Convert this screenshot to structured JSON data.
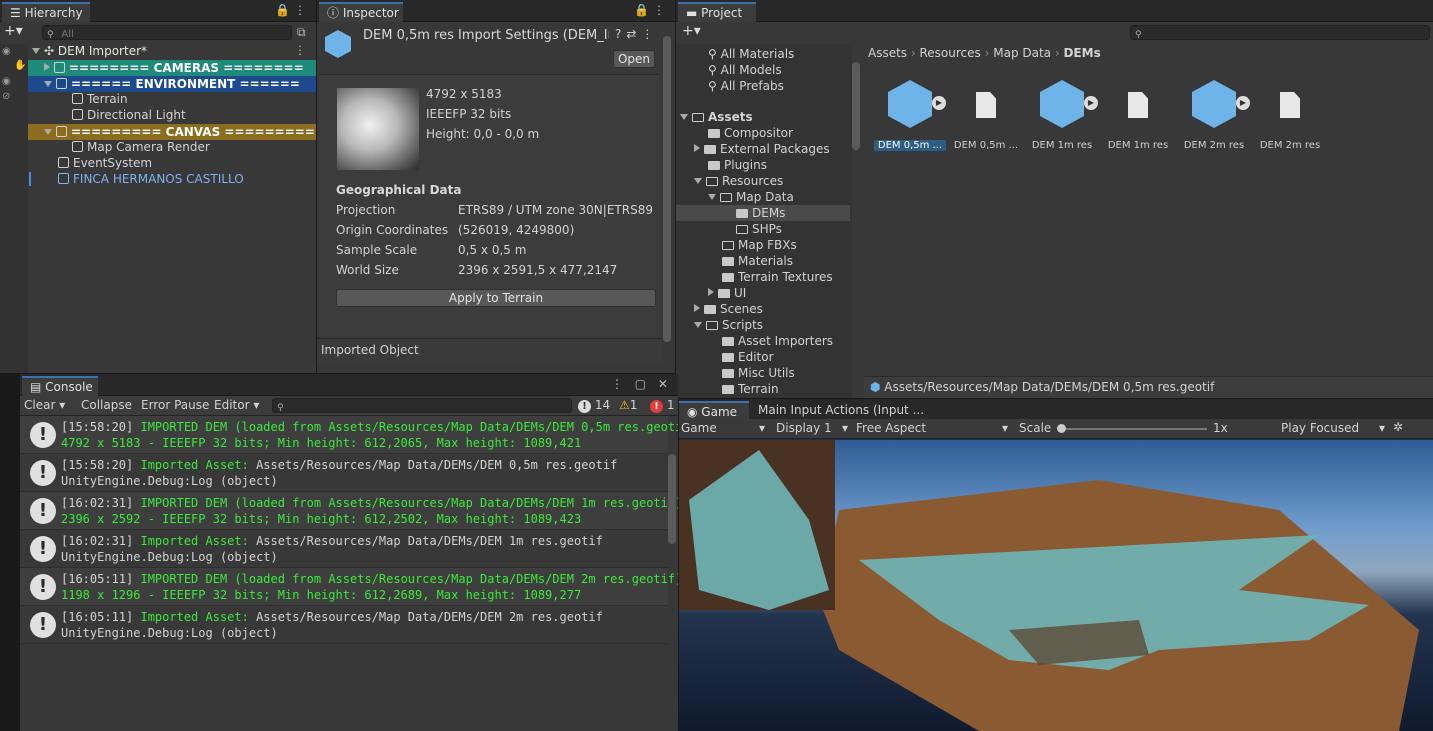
{
  "hierarchy": {
    "tab": "Hierarchy",
    "search_placeholder": "All",
    "scene": "DEM Importer*",
    "items": [
      {
        "label": "======== CAMERAS ========"
      },
      {
        "label": "====== ENVIRONMENT ======"
      },
      {
        "label": "Terrain"
      },
      {
        "label": "Directional Light"
      },
      {
        "label": "========= CANVAS ========="
      },
      {
        "label": "Map Camera Render"
      },
      {
        "label": "EventSystem"
      },
      {
        "label": "FINCA HERMANOS CASTILLO"
      }
    ],
    "colors": {
      "cameras": "#1e8a7a",
      "environment": "#1d4a8c",
      "canvas": "#8c6d1f",
      "prefab": "#7fb2ee"
    }
  },
  "inspector": {
    "tab": "Inspector",
    "title": "DEM 0,5m res Import Settings (DEM_Im",
    "open_label": "Open",
    "dimensions": "4792 x 5183",
    "format": "IEEEFP 32 bits",
    "height": "Height: 0,0 - 0,0 m",
    "section": "Geographical Data",
    "fields": [
      {
        "label": "Projection",
        "value": "ETRS89 / UTM zone 30N|ETRS89|"
      },
      {
        "label": "Origin Coordinates",
        "value": "(526019, 4249800)"
      },
      {
        "label": "Sample Scale",
        "value": "0,5 x 0,5 m"
      },
      {
        "label": "World Size",
        "value": "2396 x 2591,5 x 477,2147"
      }
    ],
    "apply_label": "Apply to Terrain",
    "imported_object": "Imported Object"
  },
  "project": {
    "tab": "Project",
    "favorites": [
      "All Materials",
      "All Models",
      "All Prefabs"
    ],
    "tree": [
      {
        "label": "Assets"
      },
      {
        "label": "Compositor"
      },
      {
        "label": "External Packages"
      },
      {
        "label": "Plugins"
      },
      {
        "label": "Resources"
      },
      {
        "label": "Map Data"
      },
      {
        "label": "DEMs"
      },
      {
        "label": "SHPs"
      },
      {
        "label": "Map FBXs"
      },
      {
        "label": "Materials"
      },
      {
        "label": "Terrain Textures"
      },
      {
        "label": "UI"
      },
      {
        "label": "Scenes"
      },
      {
        "label": "Scripts"
      },
      {
        "label": "Asset Importers"
      },
      {
        "label": "Editor"
      },
      {
        "label": "Misc Utils"
      },
      {
        "label": "Terrain"
      }
    ],
    "breadcrumb": [
      "Assets",
      "Resources",
      "Map Data",
      "DEMs"
    ],
    "assets": [
      {
        "label": "DEM 0,5m ...",
        "kind": "model",
        "selected": true
      },
      {
        "label": "DEM 0,5m ...",
        "kind": "file"
      },
      {
        "label": "DEM 1m res",
        "kind": "model"
      },
      {
        "label": "DEM 1m res",
        "kind": "file"
      },
      {
        "label": "DEM 2m res",
        "kind": "model"
      },
      {
        "label": "DEM 2m res",
        "kind": "file"
      }
    ],
    "status_path": "Assets/Resources/Map Data/DEMs/DEM 0,5m res.geotif"
  },
  "console": {
    "tab": "Console",
    "clear": "Clear",
    "collapse": "Collapse",
    "error_pause": "Error Pause",
    "editor": "Editor",
    "count_info": "14",
    "count_warn": "1",
    "count_error": "1",
    "logs": [
      {
        "time": "[15:58:20]",
        "msg": "IMPORTED DEM (loaded from Assets/Resources/Map Data/DEMs/DEM 0,5m res.geotif)",
        "detail": "4792 x 5183 - IEEEFP 32 bits; Min height: 612,2065, Max height: 1089,421"
      },
      {
        "time": "[15:58:20]",
        "msg": "Imported Asset:",
        "path": " Assets/Resources/Map Data/DEMs/DEM 0,5m res.geotif",
        "detail": "UnityEngine.Debug:Log (object)"
      },
      {
        "time": "[16:02:31]",
        "msg": "IMPORTED DEM (loaded from Assets/Resources/Map Data/DEMs/DEM 1m res.geotif)",
        "detail": "2396 x 2592 - IEEEFP 32 bits; Min height: 612,2502, Max height: 1089,423"
      },
      {
        "time": "[16:02:31]",
        "msg": "Imported Asset:",
        "path": " Assets/Resources/Map Data/DEMs/DEM 1m res.geotif",
        "detail": "UnityEngine.Debug:Log (object)"
      },
      {
        "time": "[16:05:11]",
        "msg": "IMPORTED DEM (loaded from Assets/Resources/Map Data/DEMs/DEM 2m res.geotif)",
        "detail": "1198 x 1296 - IEEEFP 32 bits; Min height: 612,2689, Max height: 1089,277"
      },
      {
        "time": "[16:05:11]",
        "msg": "Imported Asset:",
        "path": " Assets/Resources/Map Data/DEMs/DEM 2m res.geotif",
        "detail": "UnityEngine.Debug:Log (object)"
      }
    ]
  },
  "game": {
    "tab": "Game",
    "tab2": "Main Input Actions (Input ...",
    "mode": "Game",
    "display": "Display 1",
    "aspect": "Free Aspect",
    "scale_label": "Scale",
    "scale_value": "1x",
    "play": "Play Focused"
  }
}
